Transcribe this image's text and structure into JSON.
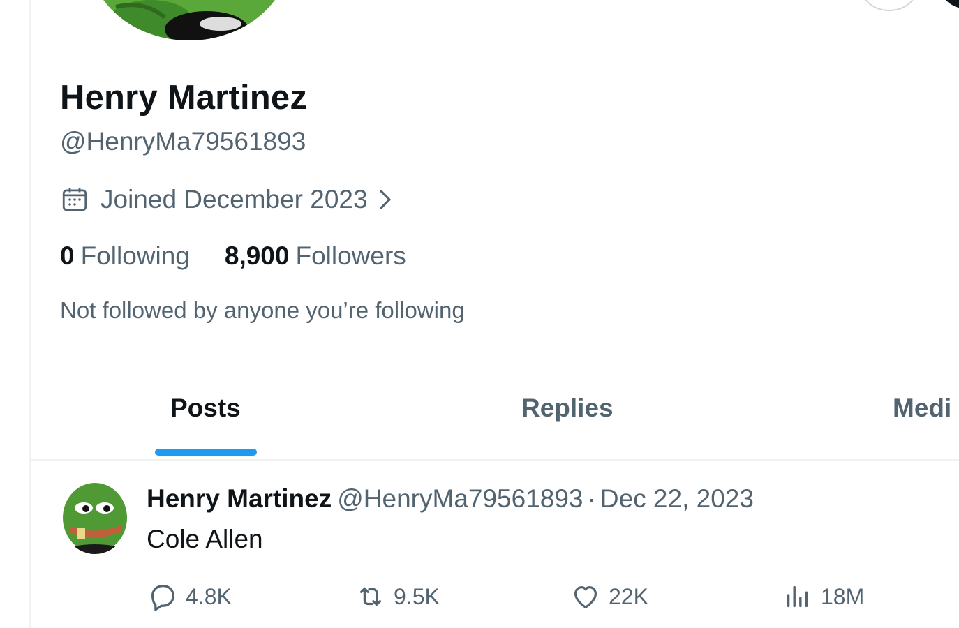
{
  "profile": {
    "display_name": "Henry Martinez",
    "handle": "@HenryMa79561893",
    "joined": "Joined December 2023",
    "following_count": "0",
    "following_label": "Following",
    "followers_count": "8,900",
    "followers_label": "Followers",
    "not_followed_text": "Not followed by anyone you’re following"
  },
  "tabs": [
    {
      "label": "Posts",
      "active": true
    },
    {
      "label": "Replies",
      "active": false
    },
    {
      "label": "Medi",
      "active": false
    }
  ],
  "post": {
    "author_name": "Henry Martinez",
    "author_handle": "@HenryMa79561893",
    "separator": "·",
    "date": "Dec 22, 2023",
    "text": "Cole Allen",
    "replies": "4.8K",
    "reposts": "9.5K",
    "likes": "22K",
    "views": "18M"
  },
  "icons": {
    "joined": "calendar-icon",
    "joined_more": "chevron-right-icon",
    "reply": "reply-bubble-icon",
    "repost": "repost-icon",
    "like": "heart-icon",
    "views": "views-chart-icon"
  },
  "colors": {
    "accent": "#1d9bf0",
    "text_primary": "#0f1419",
    "text_secondary": "#536471",
    "border": "#eff3f4",
    "avatar_green": "#5aa83a"
  }
}
